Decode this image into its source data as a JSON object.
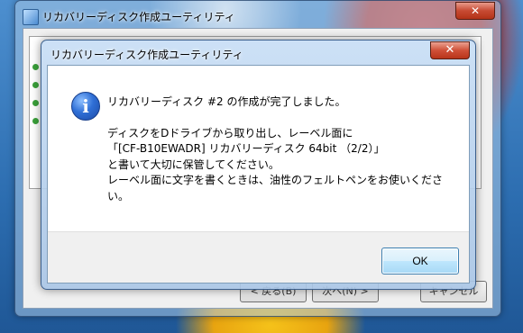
{
  "background_window": {
    "title": "リカバリーディスク作成ユーティリティ",
    "close_glyph": "✕",
    "buttons": {
      "back": "< 戻る(B)",
      "next": "次へ(N) >",
      "cancel": "キャンセル"
    }
  },
  "dialog": {
    "title": "リカバリーディスク作成ユーティリティ",
    "close_glyph": "✕",
    "icon": "info-icon",
    "icon_glyph": "i",
    "message": {
      "line1": "リカバリーディスク #2 の作成が完了しました。",
      "line2": "ディスクをDドライブから取り出し、レーベル面に",
      "line3": "「[CF-B10EWADR] リカバリーディスク 64bit （2/2）」",
      "line4": "と書いて大切に保管してください。",
      "line5": "レーベル面に文字を書くときは、油性のフェルトペンをお使いくださ",
      "line6": "い。"
    },
    "ok_label": "OK"
  },
  "colors": {
    "close_button": "#c74a32",
    "ok_border": "#3c7fb1",
    "info_icon": "#2f6fd6"
  }
}
